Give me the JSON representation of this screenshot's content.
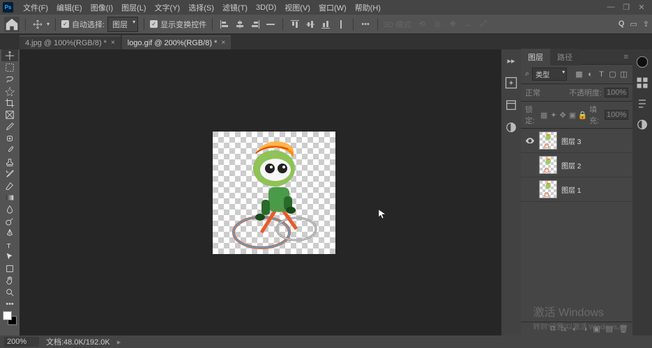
{
  "app": {
    "name": "Ps"
  },
  "menubar": {
    "items": [
      "文件(F)",
      "编辑(E)",
      "图像(I)",
      "图层(L)",
      "文字(Y)",
      "选择(S)",
      "滤镜(T)",
      "3D(D)",
      "视图(V)",
      "窗口(W)",
      "帮助(H)"
    ]
  },
  "optbar": {
    "auto_select": "自动选择:",
    "dd": "图层",
    "show_transform": "显示变换控件",
    "mode3d": "3D 模式:"
  },
  "tabs": [
    {
      "label": "4.jpg @ 100%(RGB/8) *",
      "active": false
    },
    {
      "label": "logo.gif @ 200%(RGB/8) *",
      "active": true
    }
  ],
  "panels": {
    "tabs": {
      "layers": "图层",
      "paths": "路径"
    },
    "kind_label": "类型",
    "blend": "正常",
    "opacity_label": "不透明度:",
    "opacity_val": "100%",
    "lock_label": "锁定:",
    "fill_label": "填充:",
    "fill_val": "100%",
    "layers": [
      {
        "name": "图层 3",
        "visible": true,
        "selected": false
      },
      {
        "name": "图层 2",
        "visible": false,
        "selected": false
      },
      {
        "name": "图层 1",
        "visible": false,
        "selected": false
      }
    ]
  },
  "status": {
    "zoom": "200%",
    "doc": "文档:48.0K/192.0K"
  },
  "watermark": {
    "l1": "激活 Windows",
    "l2": "转到\"设置\"以激活 Windows。"
  },
  "icons": {
    "search": "Q"
  }
}
